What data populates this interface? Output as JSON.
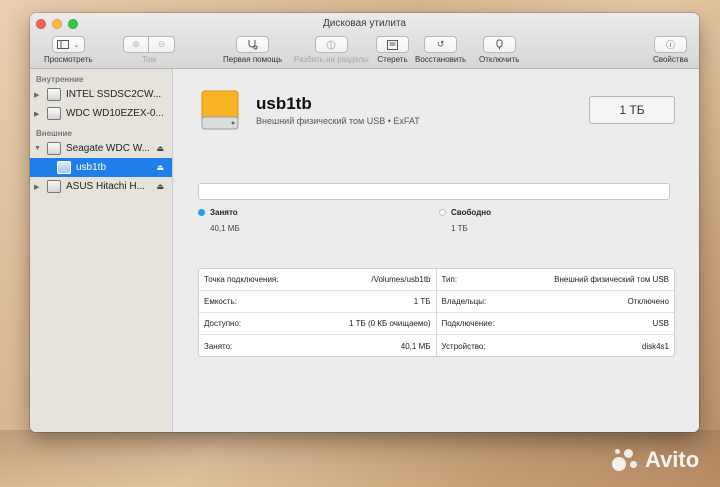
{
  "window": {
    "title": "Дисковая утилита"
  },
  "toolbar": {
    "view_label": "Просмотреть",
    "volume_label": "Том",
    "first_aid_label": "Первая помощь",
    "partition_label": "Разбить на разделы",
    "erase_label": "Стереть",
    "restore_label": "Восстановить",
    "unmount_label": "Отключить",
    "info_label": "Свойства"
  },
  "sidebar": {
    "internal_header": "Внутренние",
    "external_header": "Внешние",
    "internal": [
      {
        "label": "INTEL SSDSC2CW..."
      },
      {
        "label": "WDC WD10EZEX-0..."
      }
    ],
    "external": [
      {
        "label": "Seagate WDC W..."
      },
      {
        "label": "usb1tb"
      },
      {
        "label": "ASUS Hitachi H..."
      }
    ]
  },
  "volume": {
    "name": "usb1tb",
    "description": "Внешний физический том USB • ExFAT",
    "capacity": "1 ТБ"
  },
  "usage": {
    "used_label": "Занято",
    "used_value": "40,1 МБ",
    "used_color": "#1fa0f2",
    "free_label": "Свободно",
    "free_value": "1 ТБ",
    "free_color": "#ffffff"
  },
  "info": {
    "left": [
      {
        "key": "Точка подключения:",
        "value": "/Volumes/usb1tb"
      },
      {
        "key": "Емкость:",
        "value": "1 ТБ"
      },
      {
        "key": "Доступно:",
        "value": "1 ТБ (0 КБ очищаемо)"
      },
      {
        "key": "Занято:",
        "value": "40,1 МБ"
      }
    ],
    "right": [
      {
        "key": "Тип:",
        "value": "Внешний физический том USB"
      },
      {
        "key": "Владельцы:",
        "value": "Отключено"
      },
      {
        "key": "Подключение:",
        "value": "USB"
      },
      {
        "key": "Устройство:",
        "value": "disk4s1"
      }
    ]
  },
  "watermark": {
    "text": "Avito"
  }
}
